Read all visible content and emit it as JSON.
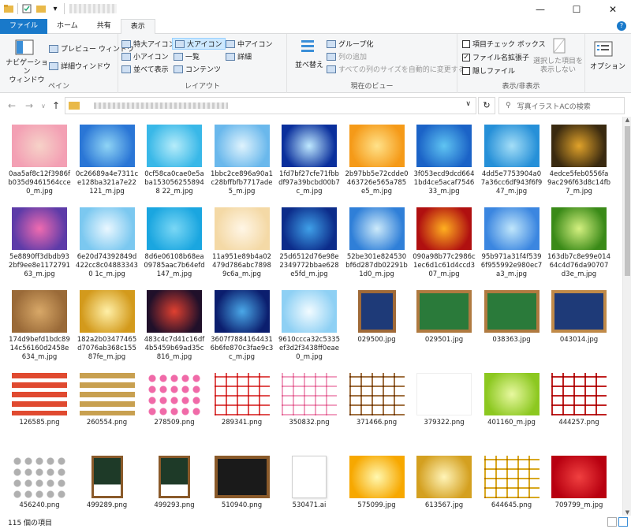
{
  "window": {
    "controls": [
      "—",
      "☐",
      "✕"
    ]
  },
  "ribbon_tabs": [
    "ファイル",
    "ホーム",
    "共有",
    "表示"
  ],
  "ribbon": {
    "pane_group": {
      "nav_pane": "ナビゲーション\nウィンドウ",
      "preview": "プレビュー ウィンドウ",
      "details": "詳細ウィンドウ",
      "label": "ペイン"
    },
    "layout_group": {
      "items": [
        "特大アイコン",
        "大アイコン",
        "中アイコン",
        "小アイコン",
        "一覧",
        "詳細",
        "並べて表示",
        "コンテンツ"
      ],
      "label": "レイアウト"
    },
    "view_group": {
      "sort": "並べ替え",
      "group_by": "グループ化",
      "add_columns": "列の追加",
      "autosize": "すべての列のサイズを自動的に変更する",
      "label": "現在のビュー"
    },
    "show_group": {
      "item_checkbox": "項目チェック ボックス",
      "extensions": "ファイル名拡張子",
      "hidden": "隠しファイル",
      "hide_selected": "選択した項目を\n表示しない",
      "label": "表示/非表示"
    },
    "options": "オプション"
  },
  "address": {
    "search_placeholder": "写真イラストACの検索"
  },
  "files": [
    {
      "name": "0aa5af8c12f3986fb035d9461564cce0_m.jpg",
      "c1": "#f3a0b4",
      "c2": "#f6d2c8"
    },
    {
      "name": "0c26689a4e7311ce128ba321a7e22121_m.jpg",
      "c1": "#2a76d6",
      "c2": "#8fd4f5"
    },
    {
      "name": "0cf58ca0cae0e5aba1530562558948 22_m.jpg",
      "c1": "#39b8e8",
      "c2": "#b6ecfa"
    },
    {
      "name": "1bbc2ce896a90a1c28bffbfb7717ade5_m.jpg",
      "c1": "#6ab8ec",
      "c2": "#dff3fd"
    },
    {
      "name": "1fd7bf27cfe71fbbdf97a39bcbd00b7c_m.jpg",
      "c1": "#0a2f9c",
      "c2": "#bfe9ff"
    },
    {
      "name": "2b97bb5e72cdde0463726e565a785e5_m.jpg",
      "c1": "#f59a18",
      "c2": "#ffe28a"
    },
    {
      "name": "3f053ecd9dcd6641bd4ce5acaf754633_m.jpg",
      "c1": "#1b63c7",
      "c2": "#5fc4f2"
    },
    {
      "name": "4dd5e7753904a07a36cc6df943f6f947_m.jpg",
      "c1": "#2690d8",
      "c2": "#a4def7"
    },
    {
      "name": "4edce5feb0556fa9ac296f63d8c14fb7_m.jpg",
      "c1": "#3a2a10",
      "c2": "#e0a22a"
    },
    {
      "name": "5e8890ff3dbdb932bf9ee8e117279163_m.jpg",
      "c1": "#5d3ba8",
      "c2": "#f06bb0"
    },
    {
      "name": "6e20d74392849d422cc8c048833430 1c_m.jpg",
      "c1": "#7bc8f0",
      "c2": "#eaf7ff"
    },
    {
      "name": "8d6e06108b68ea09785aac7b64efd147_m.jpg",
      "c1": "#1aa6e0",
      "c2": "#7ad7f5"
    },
    {
      "name": "11a951e89b4a02479d786abc78989c6a_m.jpg",
      "c1": "#f4d9a6",
      "c2": "#fff6e6"
    },
    {
      "name": "25d6512d76e98e2349772bbae628e5fd_m.jpg",
      "c1": "#0c2c8a",
      "c2": "#3fa0e8"
    },
    {
      "name": "52be301e824530bf6d287db02291b1d0_m.jpg",
      "c1": "#2f7fd8",
      "c2": "#cdeafa"
    },
    {
      "name": "090a98b77c2986c1ec6d1c61d4ccd307_m.jpg",
      "c1": "#b01010",
      "c2": "#ffb020"
    },
    {
      "name": "95b971a31f4f5396f955992e980ec7a3_m.jpg",
      "c1": "#3b86e0",
      "c2": "#c0e6fb"
    },
    {
      "name": "163db7c8e99e01464c4d76da90707d3e_m.jpg",
      "c1": "#3a8a18",
      "c2": "#d4f080"
    },
    {
      "name": "174d9befd1bdc8914c56160d2458e634_m.jpg",
      "c1": "#9a6a38",
      "c2": "#d8a868"
    },
    {
      "name": "182a2b03477465d7076ab368c15587fe_m.jpg",
      "c1": "#d39a1c",
      "c2": "#fff0a8"
    },
    {
      "name": "483c4c7d41c16df4b5459b69ad35c816_m.jpg",
      "c1": "#20102a",
      "c2": "#e04030"
    },
    {
      "name": "3607f78841644316b6fe870c3fae9c3c_m.jpg",
      "c1": "#0b1e6e",
      "c2": "#4aa8e8"
    },
    {
      "name": "9610ccca32c5335ef3d2f3438ff0eae0_m.jpg",
      "c1": "#8ed0f4",
      "c2": "#f2fbff"
    },
    {
      "name": "029500.jpg",
      "c1": "#1e3a78",
      "c2": "#a06a38",
      "shape": "board-tall"
    },
    {
      "name": "029501.jpg",
      "c1": "#2a7a3a",
      "c2": "#b07a40",
      "shape": "board"
    },
    {
      "name": "038363.jpg",
      "c1": "#2a7a3a",
      "c2": "#b07a40",
      "shape": "board"
    },
    {
      "name": "043014.jpg",
      "c1": "#1e3a78",
      "c2": "#c08a48",
      "shape": "board"
    },
    {
      "name": "126585.png",
      "c1": "#e04a30",
      "c2": "#ffffff",
      "shape": "ribbons"
    },
    {
      "name": "260554.png",
      "c1": "#c8a050",
      "c2": "#ffffff",
      "shape": "ribbons"
    },
    {
      "name": "278509.png",
      "c1": "#f06aa8",
      "c2": "#ffffff",
      "shape": "dots"
    },
    {
      "name": "289341.png",
      "c1": "#e05050",
      "c2": "#ffffff",
      "shape": "frames"
    },
    {
      "name": "350832.png",
      "c1": "#f0a0c0",
      "c2": "#ffffff",
      "shape": "frames"
    },
    {
      "name": "371466.png",
      "c1": "#a07040",
      "c2": "#ffffff",
      "shape": "frames"
    },
    {
      "name": "379322.png",
      "c1": "#ffffff",
      "c2": "#ffffff",
      "shape": "blank"
    },
    {
      "name": "401160_m.jpg",
      "c1": "#8cc820",
      "c2": "#e8f8a0"
    },
    {
      "name": "444257.png",
      "c1": "#c02020",
      "c2": "#ffffff",
      "shape": "frames"
    },
    {
      "name": "456240.png",
      "c1": "#b0b0b0",
      "c2": "#ffffff",
      "shape": "dots"
    },
    {
      "name": "499289.png",
      "c1": "#1e3a28",
      "c2": "#8a5a2a",
      "shape": "easel"
    },
    {
      "name": "499293.png",
      "c1": "#1e3a28",
      "c2": "#8a5a2a",
      "shape": "easel"
    },
    {
      "name": "510940.png",
      "c1": "#1a1a1a",
      "c2": "#8a5a2a",
      "shape": "board"
    },
    {
      "name": "530471.ai",
      "c1": "#ffffff",
      "c2": "#ffffff",
      "shape": "doc"
    },
    {
      "name": "575099.jpg",
      "c1": "#f7a800",
      "c2": "#fff8b0"
    },
    {
      "name": "613567.jpg",
      "c1": "#d4a020",
      "c2": "#fff4b8"
    },
    {
      "name": "644645.png",
      "c1": "#d8a820",
      "c2": "#ffffff",
      "shape": "frames"
    },
    {
      "name": "709799_m.jpg",
      "c1": "#b80010",
      "c2": "#f04040"
    }
  ],
  "status": {
    "count": "115 個の項目"
  }
}
